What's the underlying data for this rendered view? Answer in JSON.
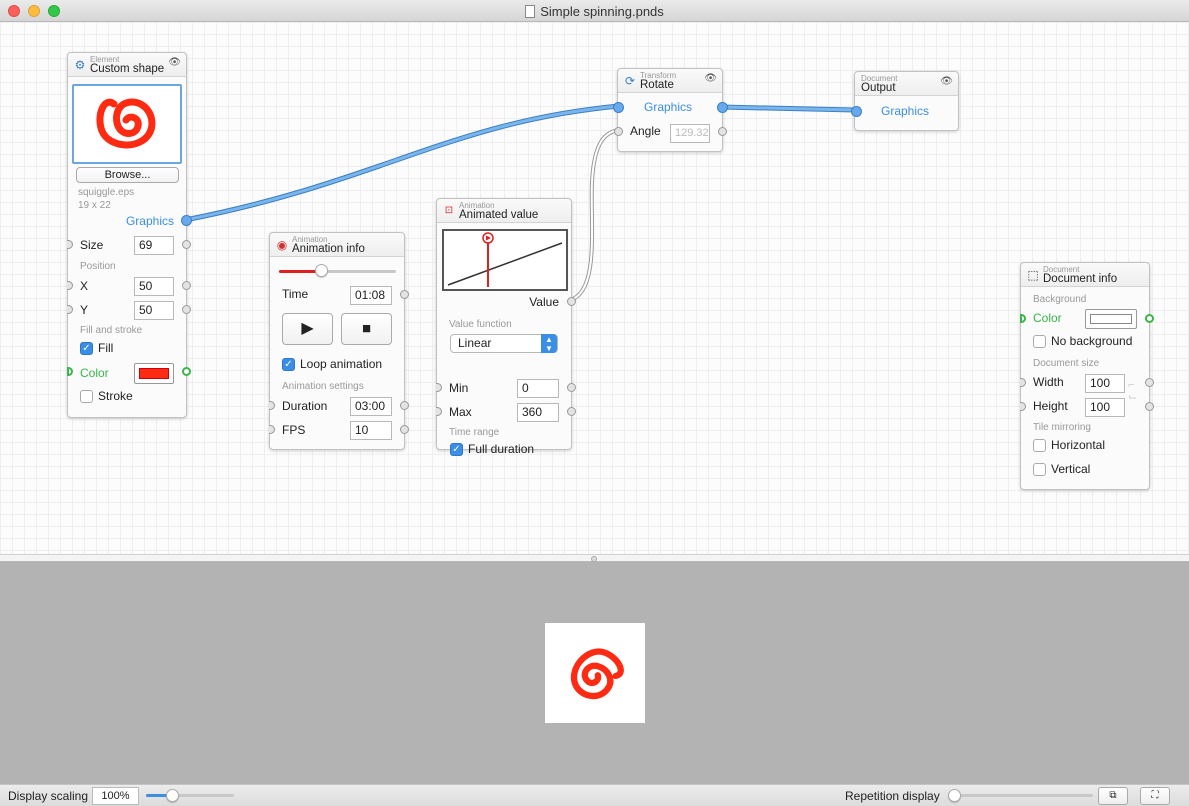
{
  "window": {
    "title": "Simple spinning.pnds"
  },
  "nodes": {
    "custom_shape": {
      "category": "Element",
      "title": "Custom shape",
      "browse_label": "Browse...",
      "file_name": "squiggle.eps",
      "file_size": "19 x 22",
      "graphics_label": "Graphics",
      "size_label": "Size",
      "size_value": "69",
      "position_section": "Position",
      "x_label": "X",
      "x_value": "50",
      "y_label": "Y",
      "y_value": "50",
      "fill_stroke_section": "Fill and stroke",
      "fill_label": "Fill",
      "fill_checked": true,
      "color_label": "Color",
      "color_value": "#ff2a12",
      "stroke_label": "Stroke",
      "stroke_checked": false
    },
    "animation_info": {
      "category": "Animation",
      "title": "Animation info",
      "progress": 0.37,
      "time_label": "Time",
      "time_value": "01:08",
      "loop_label": "Loop animation",
      "loop_checked": true,
      "settings_section": "Animation settings",
      "duration_label": "Duration",
      "duration_value": "03:00",
      "fps_label": "FPS",
      "fps_value": "10"
    },
    "animated_value": {
      "category": "Animation",
      "title": "Animated value",
      "value_label": "Value",
      "function_section": "Value function",
      "function_value": "Linear",
      "min_label": "Min",
      "min_value": "0",
      "max_label": "Max",
      "max_value": "360",
      "time_range_section": "Time range",
      "full_duration_label": "Full duration",
      "full_duration_checked": true
    },
    "rotate": {
      "category": "Transform",
      "title": "Rotate",
      "graphics_label": "Graphics",
      "angle_label": "Angle",
      "angle_value": "129.32"
    },
    "output": {
      "category": "Document",
      "title": "Output",
      "graphics_label": "Graphics"
    },
    "document_info": {
      "category": "Document",
      "title": "Document info",
      "background_section": "Background",
      "color_label": "Color",
      "no_background_label": "No background",
      "no_background_checked": false,
      "size_section": "Document size",
      "width_label": "Width",
      "width_value": "100",
      "height_label": "Height",
      "height_value": "100",
      "tile_section": "Tile mirroring",
      "horizontal_label": "Horizontal",
      "vertical_label": "Vertical"
    }
  },
  "bottom_bar": {
    "display_scaling_label": "Display scaling",
    "display_scaling_value": "100%",
    "repetition_label": "Repetition display"
  },
  "colors": {
    "accent": "#3a8ee6",
    "shape": "#ff2a12",
    "port_green": "#39b54a"
  },
  "icons": [
    "gear-icon",
    "eye-icon",
    "play-icon",
    "stop-icon",
    "rotate-icon",
    "document-frame-icon",
    "link-icon"
  ]
}
